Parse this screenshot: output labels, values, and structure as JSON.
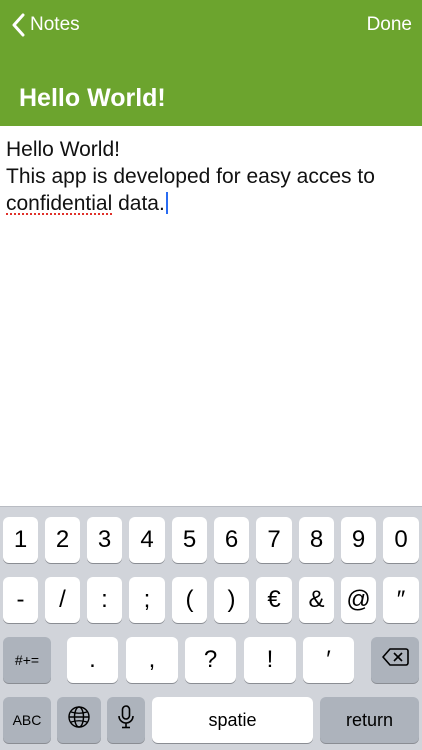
{
  "nav": {
    "back_label": "Notes",
    "done_label": "Done",
    "title": "Hello World!"
  },
  "note": {
    "line1": "Hello World!",
    "line2": "This app is developed for easy acces to",
    "line3_word": "confidential",
    "line3_rest": " data."
  },
  "keyboard": {
    "row1": [
      "1",
      "2",
      "3",
      "4",
      "5",
      "6",
      "7",
      "8",
      "9",
      "0"
    ],
    "row2": [
      "-",
      "/",
      ":",
      ";",
      "(",
      ")",
      "€",
      "&",
      "@",
      "″"
    ],
    "row3_mode": "#+=",
    "row3": [
      ".",
      ",",
      "?",
      "!",
      "′"
    ],
    "abc": "ABC",
    "space": "spatie",
    "return": "return",
    "icons": [
      "globe-icon",
      "microphone-icon",
      "backspace-icon"
    ]
  },
  "colors": {
    "header_bg": "#6ca42e",
    "caret": "#2a6cf2",
    "spell_underline": "#e0312a",
    "keyboard_bg": "#d1d4da"
  }
}
